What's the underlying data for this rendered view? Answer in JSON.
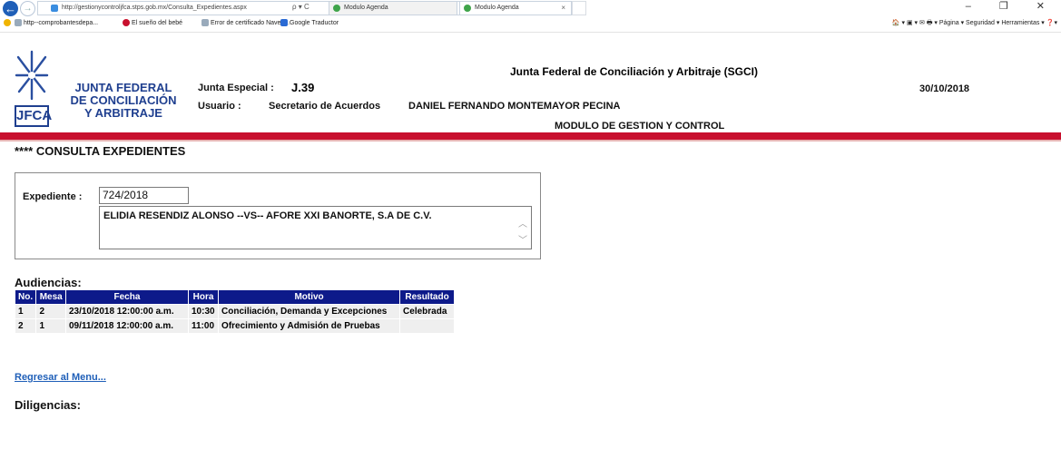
{
  "browser": {
    "url": "http://gestionycontroljfca.stps.gob.mx/Consulta_Expedientes.aspx",
    "address_actions": "ρ ▾ C",
    "tabs": [
      {
        "label": "Modulo Agenda"
      },
      {
        "label": "Modulo Agenda"
      }
    ],
    "window_controls": "– ❐ ✕",
    "favorites": [
      {
        "label": "http--comprobantesdepa..."
      },
      {
        "label": "El sueño del bebé"
      },
      {
        "label": "Error de certificado Naveg..."
      },
      {
        "label": "Google Traductor"
      }
    ],
    "tools": "🏠 ▾ ▣ ▾ ✉ 🖶 ▾ Página ▾  Seguridad ▾  Herramientas ▾  ❓▾"
  },
  "header": {
    "org_line1": "JUNTA FEDERAL",
    "org_line2": "DE CONCILIACIÓN",
    "org_line3": "Y ARBITRAJE",
    "logo_text": "JFCA",
    "system_title": "Junta Federal  de Conciliación  y Arbitraje  (SGCI)",
    "date": "30/10/2018",
    "junta_label": "Junta Especial :",
    "junta_value": "J.39",
    "usuario_label": "Usuario :",
    "usuario_role": "Secretario de Acuerdos",
    "usuario_name": "DANIEL FERNANDO  MONTEMAYOR  PECINA",
    "module_title": "MODULO  DE  GESTION Y CONTROL"
  },
  "page": {
    "title": "**** CONSULTA   EXPEDIENTES",
    "expediente_label": "Expediente :",
    "expediente_value": "724/2018",
    "partes": "ELIDIA RESENDIZ ALONSO  --VS--  AFORE XXI BANORTE, S.A DE C.V.",
    "audiencias_title": "Audiencias:",
    "regresar_link": "Regresar al Menu...",
    "diligencias_title": "Diligencias:"
  },
  "audiencias": {
    "columns": [
      "No.",
      "Mesa",
      "Fecha",
      "Hora",
      "Motivo",
      "Resultado"
    ],
    "rows": [
      [
        "1",
        "2",
        "23/10/2018 12:00:00 a.m.",
        "10:30",
        "Conciliación, Demanda y Excepciones",
        "Celebrada"
      ],
      [
        "2",
        "1",
        "09/11/2018 12:00:00 a.m.",
        "11:00",
        "Ofrecimiento y Admisión de Pruebas",
        ""
      ]
    ]
  },
  "colors": {
    "header_blue": "#0d1a8a",
    "brand_blue": "#1f3f8f",
    "red_bar": "#c8102e",
    "link_blue": "#1f5fb8"
  }
}
